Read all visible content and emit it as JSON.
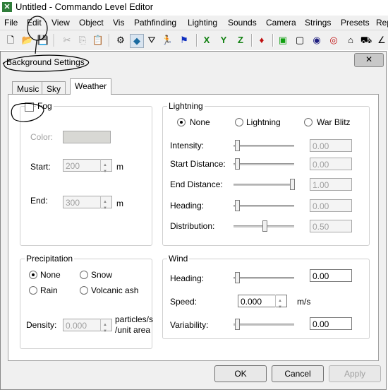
{
  "window": {
    "title": "Untitled - Commando Level Editor"
  },
  "menubar": [
    "File",
    "Edit",
    "View",
    "Object",
    "Vis",
    "Pathfinding",
    "Lighting",
    "Sounds",
    "Camera",
    "Strings",
    "Presets",
    "Rep"
  ],
  "toolbar_axes": [
    "X",
    "Y",
    "Z"
  ],
  "dialog": {
    "title": "Background Settings",
    "close": "✕",
    "tabs": [
      "Music",
      "Sky",
      "Weather"
    ],
    "fog": {
      "label": "Fog",
      "color_label": "Color:",
      "start_label": "Start:",
      "start_value": "200",
      "start_unit": "m",
      "end_label": "End:",
      "end_value": "300",
      "end_unit": "m"
    },
    "lightning": {
      "group": "Lightning",
      "options": [
        "None",
        "Lightning",
        "War Blitz"
      ],
      "selected": "None",
      "intensity_label": "Intensity:",
      "intensity": "0.00",
      "start_label": "Start Distance:",
      "start": "0.00",
      "end_label": "End Distance:",
      "end": "1.00",
      "heading_label": "Heading:",
      "heading": "0.00",
      "distribution_label": "Distribution:",
      "distribution": "0.50"
    },
    "precipitation": {
      "group": "Precipitation",
      "options": [
        "None",
        "Snow",
        "Rain",
        "Volcanic ash"
      ],
      "selected": "None",
      "density_label": "Density:",
      "density": "0.000",
      "unit_line1": "particles/s",
      "unit_line2": "/unit area"
    },
    "wind": {
      "group": "Wind",
      "heading_label": "Heading:",
      "heading": "0.00",
      "speed_label": "Speed:",
      "speed": "0.000",
      "speed_unit": "m/s",
      "variability_label": "Variability:",
      "variability": "0.00"
    },
    "buttons": {
      "ok": "OK",
      "cancel": "Cancel",
      "apply": "Apply"
    }
  }
}
